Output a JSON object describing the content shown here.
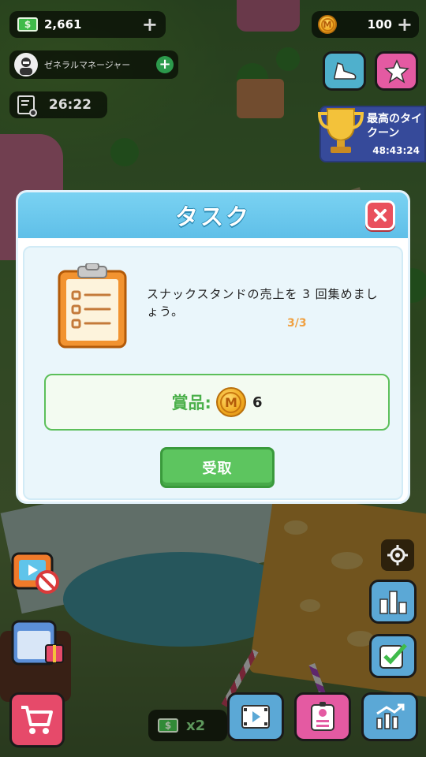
{
  "hud": {
    "cash": "2,661",
    "coins": "100",
    "role_title": "ゼネラルマネージャー",
    "timer": "26:22",
    "cash_icon_symbol": "$",
    "coin_symbol": "M"
  },
  "event": {
    "title": "最高のタイクーン",
    "countdown": "48:43:24"
  },
  "bottom": {
    "boost_multiplier": "x2"
  },
  "modal": {
    "title": "タスク",
    "task_description": "スナックスタンドの売上を 3 回集めましょう。",
    "progress": "3/3",
    "reward_label": "賞品:",
    "reward_amount": "6",
    "claim_label": "受取"
  },
  "colors": {
    "header_blue": "#5fbfe8",
    "close_red": "#e9505d",
    "reward_green": "#4ab04a",
    "claim_green": "#5dc55f",
    "progress_orange": "#f0a040"
  }
}
